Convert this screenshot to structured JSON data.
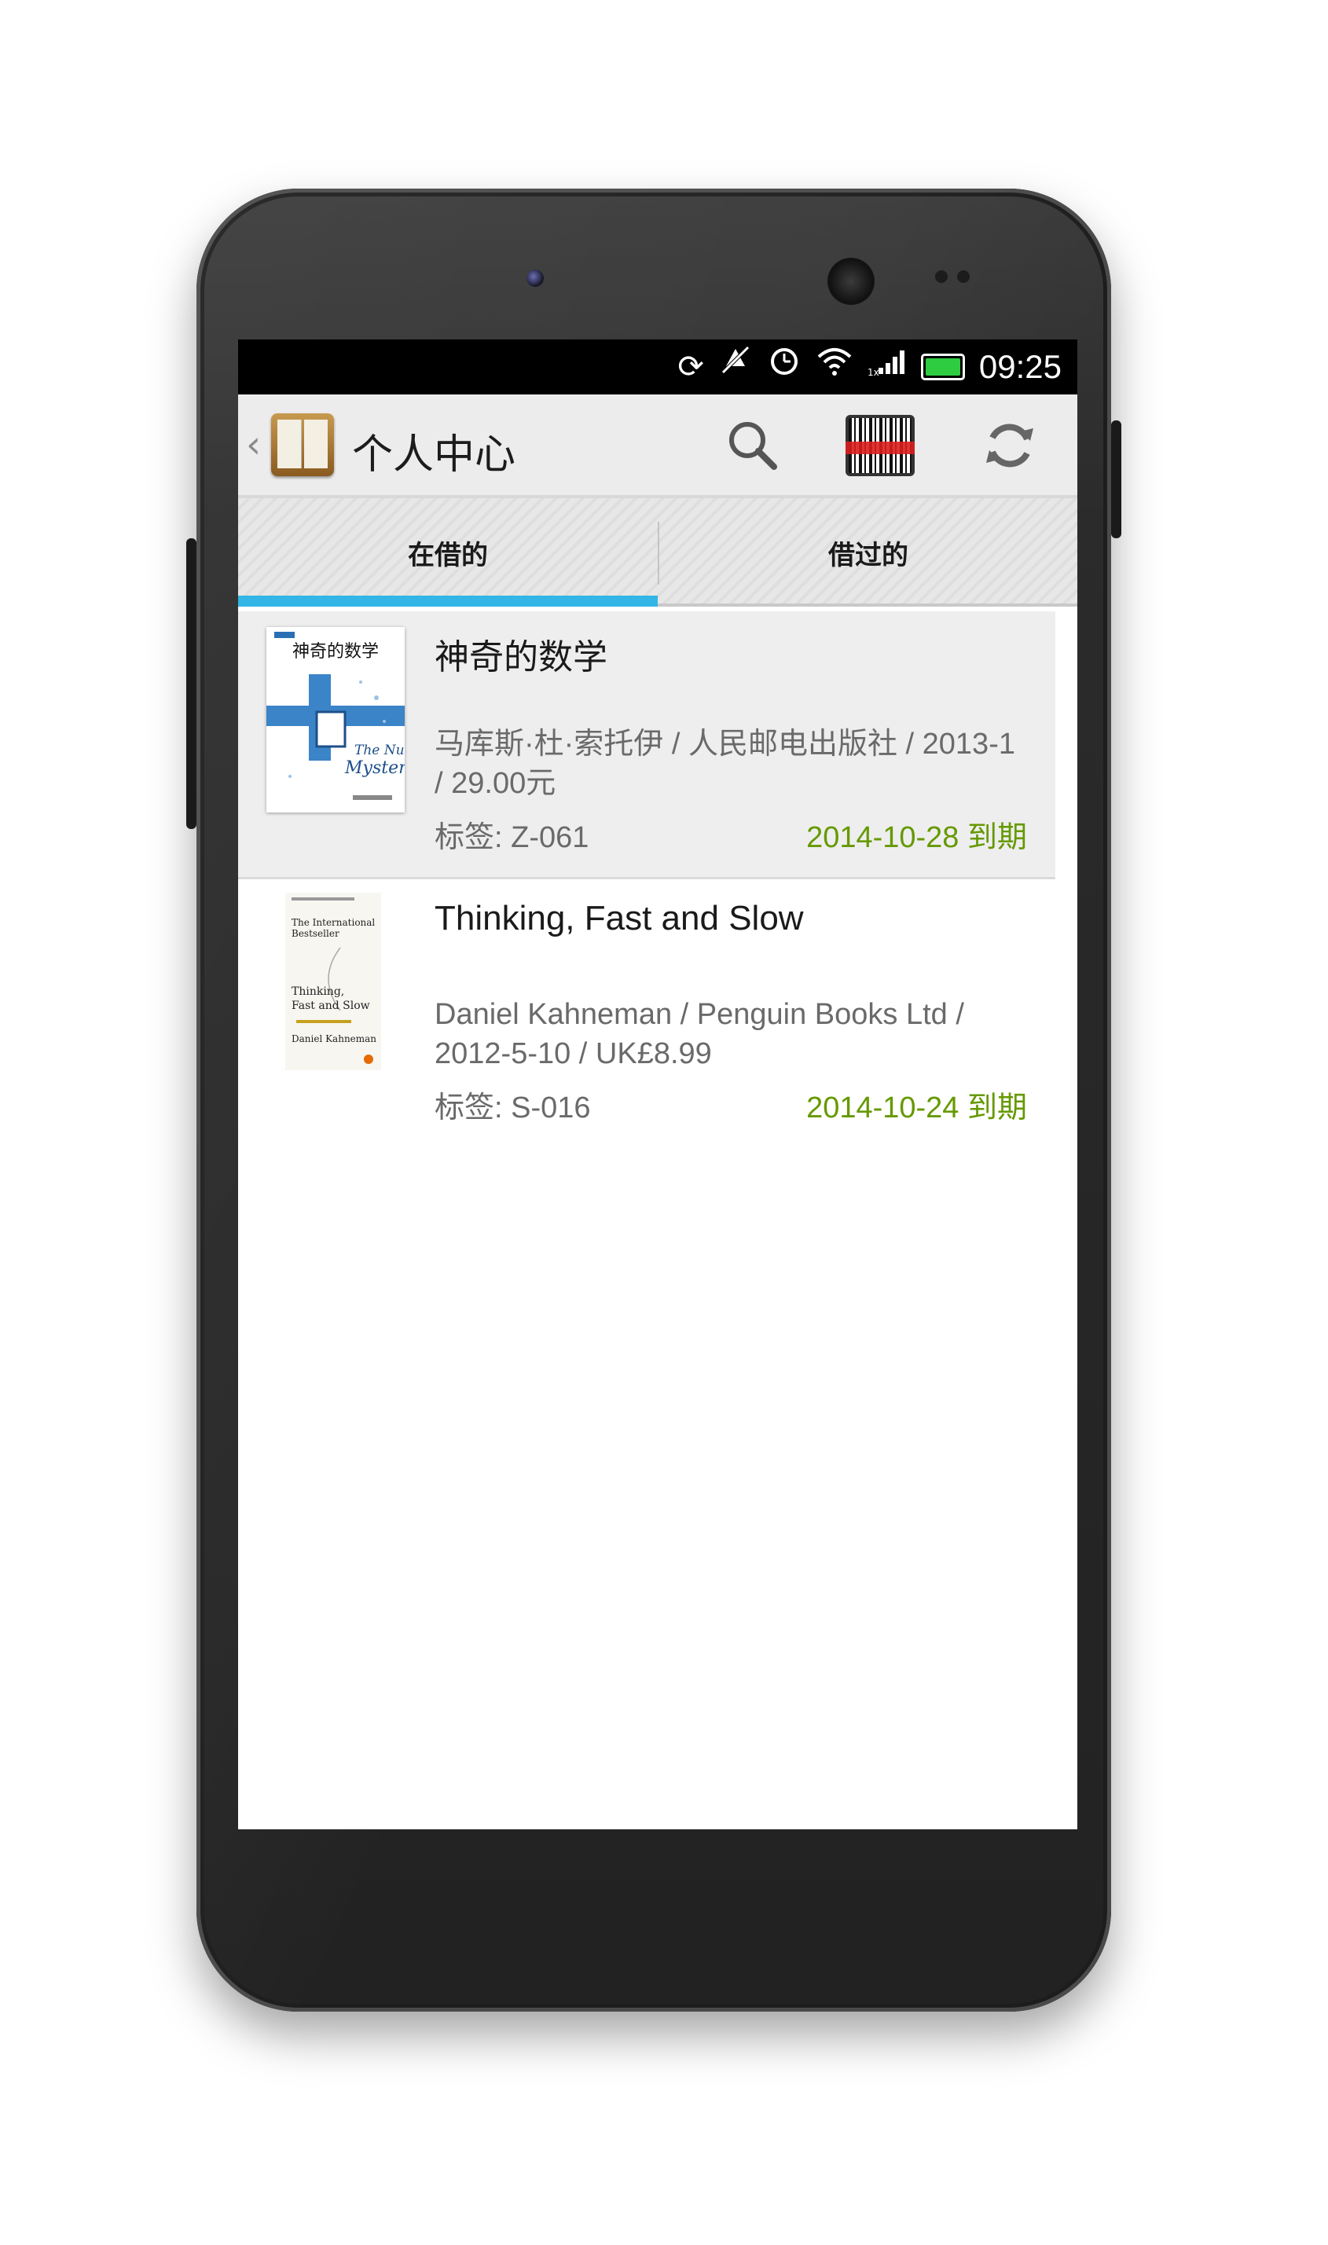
{
  "status_bar": {
    "time": "09:25"
  },
  "action_bar": {
    "title": "个人中心",
    "back_glyph": "‹"
  },
  "tabs": [
    {
      "label": "在借的",
      "selected": true
    },
    {
      "label": "借过的",
      "selected": false
    }
  ],
  "books": [
    {
      "title": "神奇的数学",
      "meta": "马库斯·杜·索托伊 / 人民邮电出版社 / 2013-1 / 29.00元",
      "tag": "标签: Z-061",
      "due": "2014-10-28 到期"
    },
    {
      "title": "Thinking, Fast and Slow",
      "meta": "Daniel Kahneman / Penguin Books Ltd / 2012-5-10 / UK£8.99",
      "tag": "标签: S-016",
      "due": "2014-10-24 到期"
    }
  ],
  "colors": {
    "accent_tab": "#33b5e5",
    "due_green": "#669900",
    "actionbar_bg": "#ececec"
  }
}
